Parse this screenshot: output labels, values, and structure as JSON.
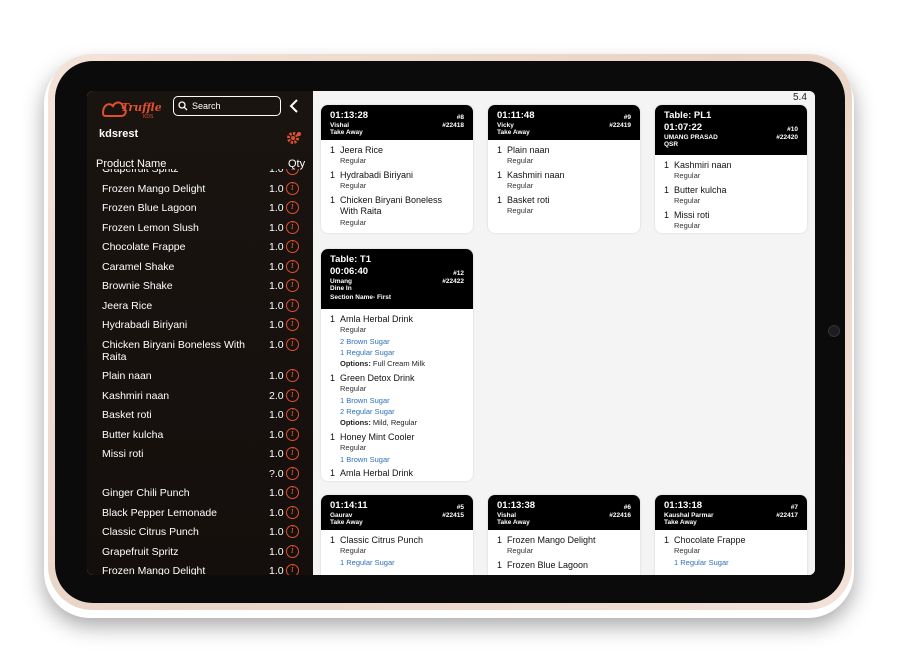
{
  "sidebar": {
    "logo_text": "Truffle",
    "logo_sub": "KDS",
    "search_placeholder": "Search",
    "restaurant": "kdsrest",
    "col_product": "Product Name",
    "col_qty": "Qty",
    "items": [
      {
        "name": "Grapefruit Spritz",
        "qty": "1.0"
      },
      {
        "name": "Frozen Mango Delight",
        "qty": "1.0"
      },
      {
        "name": "Frozen Blue Lagoon",
        "qty": "1.0"
      },
      {
        "name": "Frozen Lemon Slush",
        "qty": "1.0"
      },
      {
        "name": "Chocolate Frappe",
        "qty": "1.0"
      },
      {
        "name": "Caramel Shake",
        "qty": "1.0"
      },
      {
        "name": "Brownie Shake",
        "qty": "1.0"
      },
      {
        "name": "Jeera Rice",
        "qty": "1.0"
      },
      {
        "name": "Hydrabadi Biriyani",
        "qty": "1.0"
      },
      {
        "name": "Chicken Biryani Boneless With Raita",
        "qty": "1.0"
      },
      {
        "name": "Plain naan",
        "qty": "1.0"
      },
      {
        "name": "Kashmiri naan",
        "qty": "2.0"
      },
      {
        "name": "Basket roti",
        "qty": "1.0"
      },
      {
        "name": "Butter kulcha",
        "qty": "1.0"
      },
      {
        "name": "Missi roti",
        "qty": "1.0"
      },
      {
        "name": "",
        "qty": "?.0"
      },
      {
        "name": "Ginger Chili Punch",
        "qty": "1.0"
      },
      {
        "name": "Black Pepper Lemonade",
        "qty": "1.0"
      },
      {
        "name": "Classic Citrus Punch",
        "qty": "1.0"
      },
      {
        "name": "Grapefruit Spritz",
        "qty": "1.0"
      },
      {
        "name": "Frozen Mango Delight",
        "qty": "1.0"
      }
    ]
  },
  "version": "5.4",
  "orders": [
    {
      "table": "",
      "time": "01:13:28",
      "num": "#8",
      "customer": "Vishal",
      "order_id": "#22418",
      "type": "Take Away",
      "section": "",
      "lines": [
        {
          "kind": "item",
          "qty": "1",
          "text": "Jeera Rice"
        },
        {
          "kind": "sub",
          "text": "Regular"
        },
        {
          "kind": "item",
          "qty": "1",
          "text": "Hydrabadi Biriyani"
        },
        {
          "kind": "sub",
          "text": "Regular"
        },
        {
          "kind": "item",
          "qty": "1",
          "text": "Chicken Biryani Boneless"
        },
        {
          "kind": "item2",
          "text": "With Raita"
        },
        {
          "kind": "sub",
          "text": "Regular"
        }
      ]
    },
    {
      "table": "",
      "time": "01:11:48",
      "num": "#9",
      "customer": "Vicky",
      "order_id": "#22419",
      "type": "Take Away",
      "section": "",
      "lines": [
        {
          "kind": "item",
          "qty": "1",
          "text": "Plain naan"
        },
        {
          "kind": "sub",
          "text": "Regular"
        },
        {
          "kind": "item",
          "qty": "1",
          "text": "Kashmiri naan"
        },
        {
          "kind": "sub",
          "text": "Regular"
        },
        {
          "kind": "item",
          "qty": "1",
          "text": "Basket roti"
        },
        {
          "kind": "sub",
          "text": "Regular"
        }
      ]
    },
    {
      "table": "Table: PL1",
      "time": "01:07:22",
      "num": "#10",
      "customer": "UMANG PRASAD",
      "order_id": "#22420",
      "type": "QSR",
      "section": "",
      "lines": [
        {
          "kind": "item",
          "qty": "1",
          "text": "Kashmiri naan"
        },
        {
          "kind": "sub",
          "text": "Regular"
        },
        {
          "kind": "item",
          "qty": "1",
          "text": "Butter kulcha"
        },
        {
          "kind": "sub",
          "text": "Regular"
        },
        {
          "kind": "item",
          "qty": "1",
          "text": "Missi roti"
        },
        {
          "kind": "sub",
          "text": "Regular"
        }
      ]
    },
    {
      "table": "Table: T1",
      "time": "00:06:40",
      "num": "#12",
      "customer": "Umang",
      "order_id": "#22422",
      "type": "Dine In",
      "section": "Section Name- First",
      "lines": [
        {
          "kind": "item",
          "qty": "1",
          "text": "Amla Herbal Drink"
        },
        {
          "kind": "sub",
          "text": "Regular"
        },
        {
          "kind": "mod",
          "text": "2  Brown Sugar"
        },
        {
          "kind": "mod",
          "text": "1  Regular Sugar"
        },
        {
          "kind": "opt",
          "label": "Options:",
          "text": " Full Cream Milk"
        },
        {
          "kind": "item",
          "qty": "1",
          "text": "Green Detox Drink"
        },
        {
          "kind": "sub",
          "text": "Regular"
        },
        {
          "kind": "mod",
          "text": "1  Brown Sugar"
        },
        {
          "kind": "mod",
          "text": "2  Regular Sugar"
        },
        {
          "kind": "opt",
          "label": "Options:",
          "text": " Mild, Regular"
        },
        {
          "kind": "item",
          "qty": "1",
          "text": "Honey Mint Cooler"
        },
        {
          "kind": "sub",
          "text": "Regular"
        },
        {
          "kind": "mod",
          "text": "1  Brown Sugar"
        },
        {
          "kind": "item",
          "qty": "1",
          "text": "Amla Herbal Drink"
        }
      ]
    },
    {
      "table": "",
      "time": "01:14:11",
      "num": "#5",
      "customer": "Gaurav",
      "order_id": "#22415",
      "type": "Take Away",
      "section": "",
      "lines": [
        {
          "kind": "item",
          "qty": "1",
          "text": "Classic Citrus Punch"
        },
        {
          "kind": "sub",
          "text": "Regular"
        },
        {
          "kind": "mod",
          "text": "1  Regular Sugar"
        }
      ]
    },
    {
      "table": "",
      "time": "01:13:38",
      "num": "#6",
      "customer": "Vishal",
      "order_id": "#22416",
      "type": "Take Away",
      "section": "",
      "lines": [
        {
          "kind": "item",
          "qty": "1",
          "text": "Frozen Mango Delight"
        },
        {
          "kind": "sub",
          "text": "Regular"
        },
        {
          "kind": "item",
          "qty": "1",
          "text": "Frozen Blue Lagoon"
        }
      ]
    },
    {
      "table": "",
      "time": "01:13:18",
      "num": "#7",
      "customer": "Kaushal Parmar",
      "order_id": "#22417",
      "type": "Take Away",
      "section": "",
      "lines": [
        {
          "kind": "item",
          "qty": "1",
          "text": "Chocolate Frappe"
        },
        {
          "kind": "sub",
          "text": "Regular"
        },
        {
          "kind": "mod",
          "text": "1  Regular Sugar"
        }
      ]
    }
  ],
  "colors": {
    "accent": "#e05030",
    "sidebar_bg": "#1a1411",
    "card_header": "#000000",
    "modifier": "#2e6fb8"
  }
}
